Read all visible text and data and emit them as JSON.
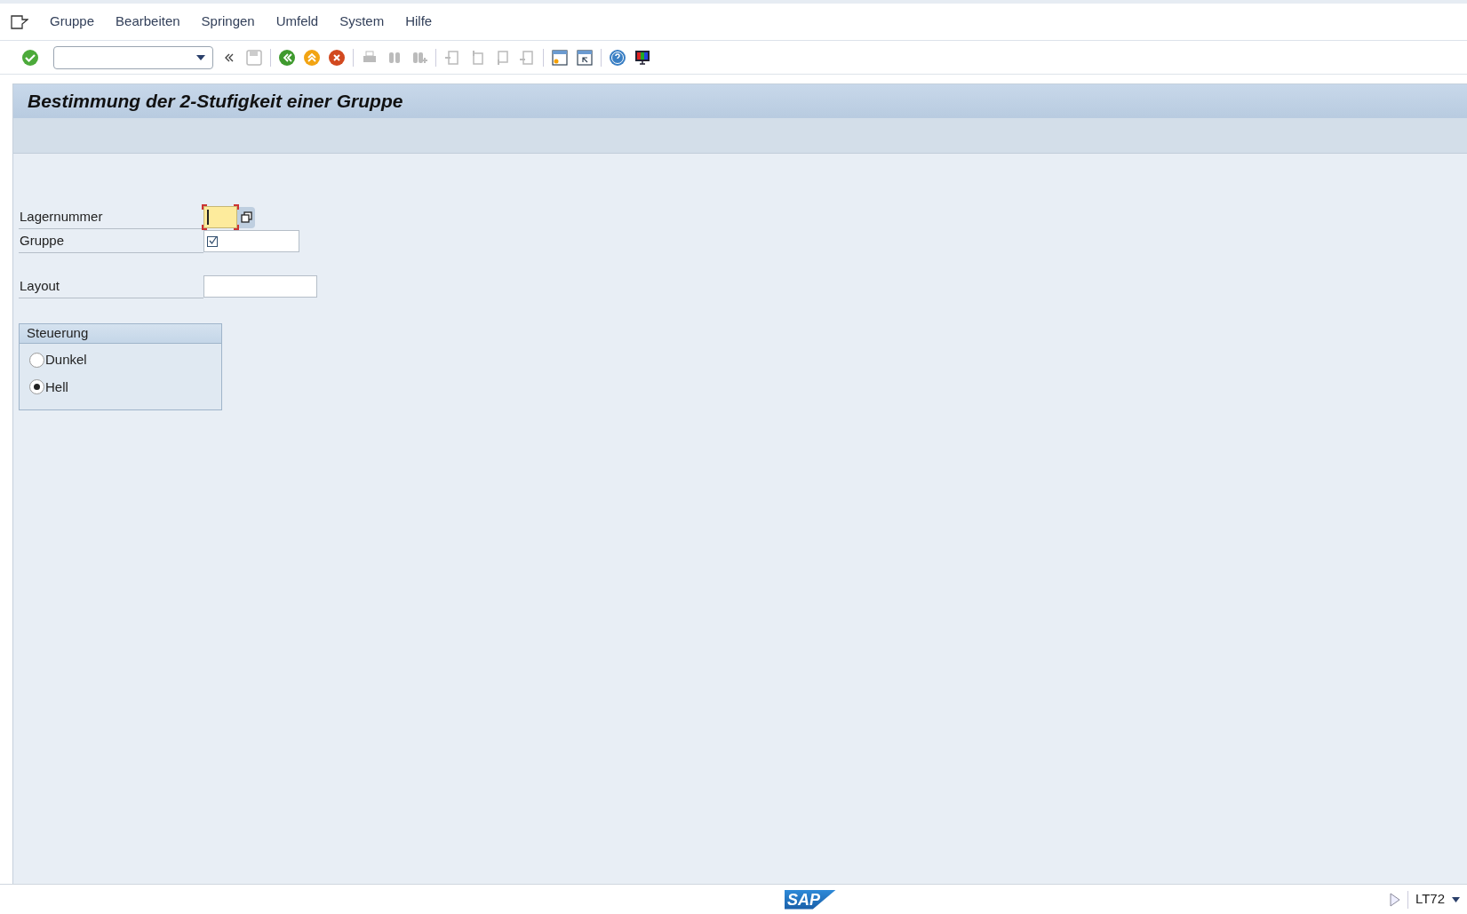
{
  "menu": [
    "Gruppe",
    "Bearbeiten",
    "Springen",
    "Umfeld",
    "System",
    "Hilfe"
  ],
  "title": "Bestimmung der 2-Stufigkeit einer Gruppe",
  "fields": [
    {
      "label": "Lagernummer",
      "kind": "required"
    },
    {
      "label": "Gruppe",
      "kind": "check"
    },
    {
      "label": "Layout",
      "kind": "plain"
    }
  ],
  "group": {
    "title": "Steuerung",
    "options": [
      {
        "label": "Dunkel",
        "selected": false
      },
      {
        "label": "Hell",
        "selected": true
      }
    ]
  },
  "status_bar": {
    "logo": "SAP",
    "transaction": "LT72"
  }
}
